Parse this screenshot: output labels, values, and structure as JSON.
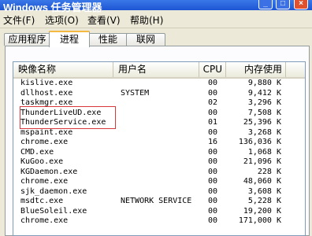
{
  "window": {
    "title": "Windows 任务管理器",
    "buttons": {
      "minimize": "_",
      "maximize": "□",
      "close": "×"
    }
  },
  "menu": [
    {
      "label": "文件(F)"
    },
    {
      "label": "选项(O)"
    },
    {
      "label": "查看(V)"
    },
    {
      "label": "帮助(H)"
    }
  ],
  "tabs": [
    {
      "label": "应用程序"
    },
    {
      "label": "进程",
      "active": true
    },
    {
      "label": "性能"
    },
    {
      "label": "联网"
    }
  ],
  "table": {
    "headers": [
      "映像名称",
      "用户名",
      "CPU",
      "内存使用"
    ],
    "rows": [
      {
        "name": "kislive.exe",
        "user": "",
        "cpu": "00",
        "mem": "9,880 K"
      },
      {
        "name": "dllhost.exe",
        "user": "SYSTEM",
        "cpu": "00",
        "mem": "9,412 K"
      },
      {
        "name": "taskmgr.exe",
        "user": "",
        "cpu": "02",
        "mem": "3,296 K"
      },
      {
        "name": "ThunderLiveUD.exe",
        "user": "",
        "cpu": "00",
        "mem": "7,508 K"
      },
      {
        "name": "ThunderService.exe",
        "user": "",
        "cpu": "01",
        "mem": "25,396 K"
      },
      {
        "name": "mspaint.exe",
        "user": "",
        "cpu": "00",
        "mem": "3,268 K"
      },
      {
        "name": "chrome.exe",
        "user": "",
        "cpu": "16",
        "mem": "136,036 K"
      },
      {
        "name": "CMD.exe",
        "user": "",
        "cpu": "00",
        "mem": "1,068 K"
      },
      {
        "name": "KuGoo.exe",
        "user": "",
        "cpu": "00",
        "mem": "21,096 K"
      },
      {
        "name": "KGDaemon.exe",
        "user": "",
        "cpu": "00",
        "mem": "228 K"
      },
      {
        "name": "chrome.exe",
        "user": "",
        "cpu": "00",
        "mem": "48,060 K"
      },
      {
        "name": "sjk_daemon.exe",
        "user": "",
        "cpu": "00",
        "mem": "3,608 K"
      },
      {
        "name": "msdtc.exe",
        "user": "NETWORK SERVICE",
        "cpu": "00",
        "mem": "5,228 K"
      },
      {
        "name": "BlueSoleil.exe",
        "user": "",
        "cpu": "00",
        "mem": "19,200 K"
      },
      {
        "name": "chrome.exe",
        "user": "",
        "cpu": "00",
        "mem": "171,000 K"
      }
    ]
  }
}
